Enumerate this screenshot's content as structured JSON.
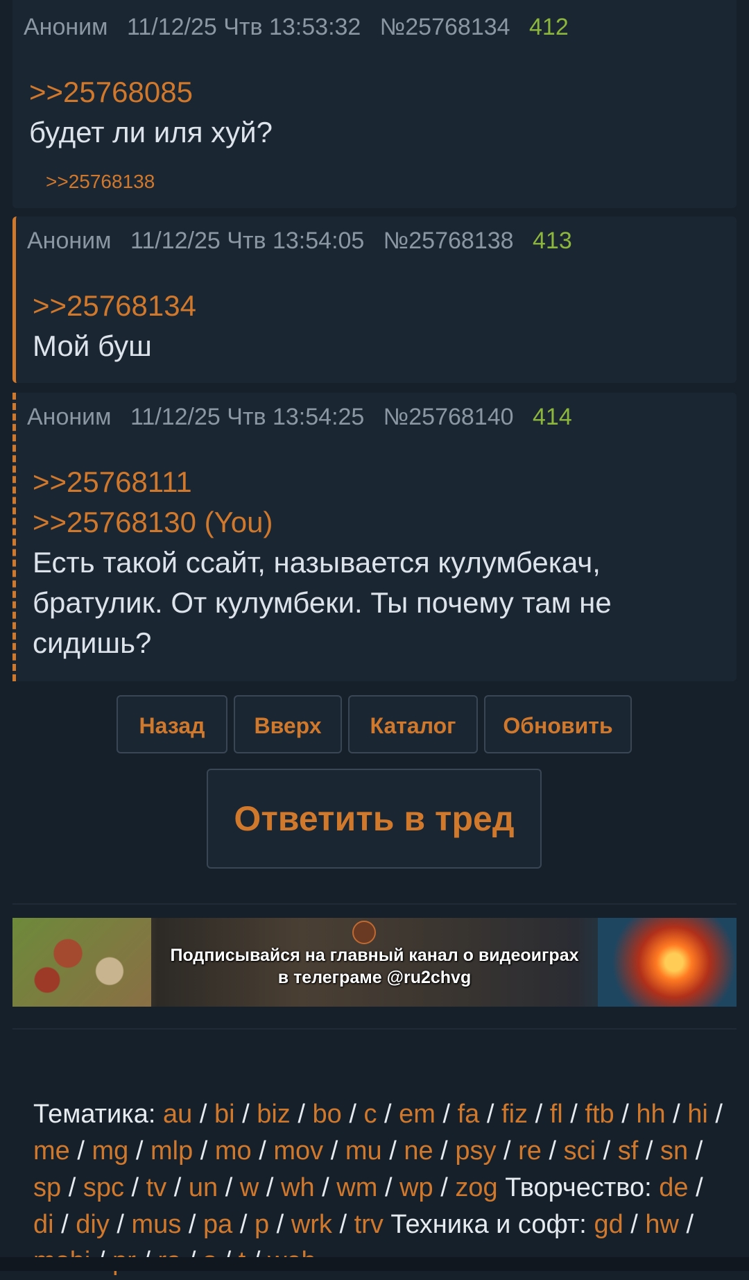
{
  "posts": [
    {
      "author": "Аноним",
      "date": "11/12/25 Чтв 13:53:32",
      "id": "№25768134",
      "number": "412",
      "refs": [
        ">>25768085"
      ],
      "text": [
        "будет ли иля хуй?"
      ],
      "replies": [
        ">>25768138"
      ]
    },
    {
      "author": "Аноним",
      "date": "11/12/25 Чтв 13:54:05",
      "id": "№25768138",
      "number": "413",
      "refs": [
        ">>25768134"
      ],
      "text": [
        "Мой буш"
      ]
    },
    {
      "author": "Аноним",
      "date": "11/12/25 Чтв 13:54:25",
      "id": "№25768140",
      "number": "414",
      "refs": [
        ">>25768111",
        ">>25768130 (You)"
      ],
      "text": [
        "Есть такой ссайт, называется кулумбекач,",
        "братулик. От кулумбеки. Ты почему там не",
        "сидишь?"
      ]
    }
  ],
  "nav": {
    "back": "Назад",
    "top": "Вверх",
    "catalog": "Каталог",
    "refresh": "Обновить",
    "reply": "Ответить в тред"
  },
  "banner": {
    "line1": "Подписывайся на главный канал о видеоиграх",
    "line2": "в телеграме @ru2chvg"
  },
  "footer": {
    "thematic_label": "Тематика:",
    "thematic": [
      "au",
      "bi",
      "biz",
      "bo",
      "c",
      "em",
      "fa",
      "fiz",
      "fl",
      "ftb",
      "hh",
      "hi",
      "me",
      "mg",
      "mlp",
      "mo",
      "mov",
      "mu",
      "ne",
      "psy",
      "re",
      "sci",
      "sf",
      "sn",
      "sp",
      "spc",
      "tv",
      "un",
      "w",
      "wh",
      "wm",
      "wp",
      "zog"
    ],
    "creative_label": "Творчество:",
    "creative": [
      "de",
      "di",
      "diy",
      "mus",
      "pa",
      "p",
      "wrk",
      "trv"
    ],
    "tech_label": "Техника и софт:",
    "tech": [
      "gd",
      "hw",
      "mobi",
      "pr",
      "ra",
      "s",
      "t",
      "web"
    ]
  },
  "colors": {
    "background": "#16202b",
    "post_bg": "#1b2633",
    "accent": "#d0782c",
    "post_number": "#8db63d",
    "meta": "#8b97a3"
  }
}
